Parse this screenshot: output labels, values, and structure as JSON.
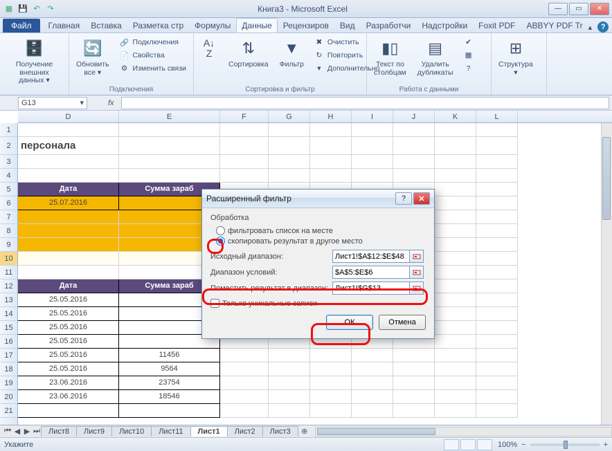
{
  "titlebar": {
    "title": "Книга3 - Microsoft Excel"
  },
  "tabs": {
    "file": "Файл",
    "list": [
      "Главная",
      "Вставка",
      "Разметка стр",
      "Формулы",
      "Данные",
      "Рецензиров",
      "Вид",
      "Разработчи",
      "Надстройки",
      "Foxit PDF",
      "ABBYY PDF Tr"
    ],
    "active_index": 4
  },
  "ribbon": {
    "group1": {
      "btn1": "Получение\nвнешних данных ▾"
    },
    "group2": {
      "refresh": "Обновить\nвсе ▾",
      "s1": "Подключения",
      "s2": "Свойства",
      "s3": "Изменить связи",
      "label": "Подключения"
    },
    "group3": {
      "sort": "Сортировка",
      "filter": "Фильтр",
      "s1": "Очистить",
      "s2": "Повторить",
      "s3": "Дополнительно",
      "label": "Сортировка и фильтр"
    },
    "group4": {
      "ttc": "Текст по\nстолбцам",
      "dup": "Удалить\nдубликаты",
      "label": "Работа с данными"
    },
    "group5": {
      "struct": "Структура\n▾"
    }
  },
  "formula": {
    "namebox": "G13",
    "fx": "fx"
  },
  "columns": [
    "D",
    "E",
    "F",
    "G",
    "H",
    "I",
    "J",
    "K",
    "L"
  ],
  "rows": [
    "1",
    "2",
    "3",
    "4",
    "5",
    "6",
    "7",
    "8",
    "9",
    "10",
    "11",
    "12",
    "13",
    "14",
    "15",
    "16",
    "17",
    "18",
    "19",
    "20",
    "21"
  ],
  "cells": {
    "d2": "персонала",
    "hdr_date": "Дата",
    "hdr_sum": "Сумма зараб",
    "d6": "25.07.2016",
    "dates": [
      "25.05.2016",
      "25.05.2016",
      "25.05.2016",
      "25.05.2016",
      "25.05.2016",
      "25.05.2016",
      "23.06.2016",
      "23.06.2016"
    ],
    "sums": [
      "",
      "",
      "",
      "",
      "",
      "11456",
      "9564",
      "23754",
      "18546"
    ]
  },
  "dialog": {
    "title": "Расширенный фильтр",
    "group": "Обработка",
    "r1": "фильтровать список на месте",
    "r2": "скопировать результат в другое место",
    "f1_label": "Исходный диапазон:",
    "f1_value": "Лист1!$A$12:$E$48",
    "f2_label": "Диапазон условий:",
    "f2_value": "$A$5:$E$6",
    "f3_label": "Поместить результат в диапазон:",
    "f3_value": "Лист1!$G$13",
    "cb": "Только уникальные записи",
    "ok": "ОК",
    "cancel": "Отмена"
  },
  "sheets": {
    "list": [
      "Лист8",
      "Лист9",
      "Лист10",
      "Лист11",
      "Лист1",
      "Лист2",
      "Лист3"
    ],
    "active_index": 4
  },
  "status": {
    "left": "Укажите",
    "zoom": "100%",
    "minus": "−",
    "plus": "+"
  }
}
